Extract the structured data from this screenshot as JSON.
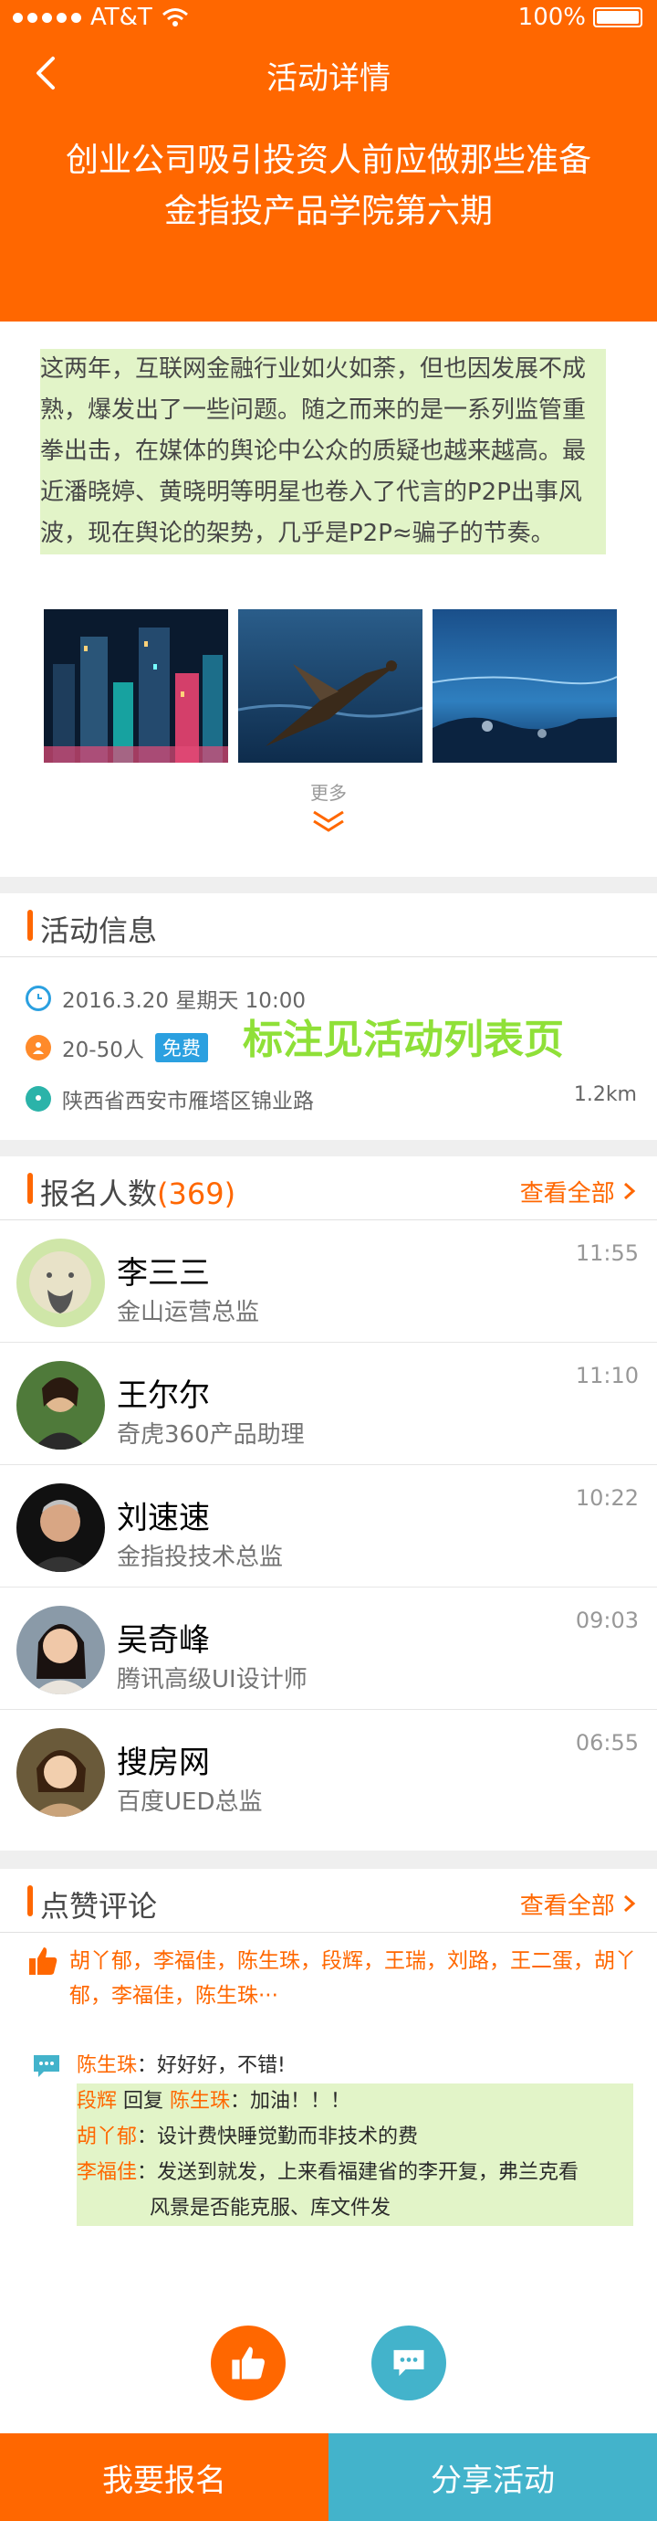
{
  "status": {
    "carrier": "AT&T",
    "battery": "100%"
  },
  "nav": {
    "title": "活动详情"
  },
  "event": {
    "title_line1": "创业公司吸引投资人前应做那些准备",
    "title_line2": "金指投产品学院第六期"
  },
  "description": {
    "text": "这两年，互联网金融行业如火如荼，但也因发展不成熟，爆发出了一些问题。随之而来的是一系列监管重拳出击，在媒体的舆论中公众的质疑也越来越高。最近潘晓婷、黄晓明等明星也卷入了代言的P2P出事风波，现在舆论的架势，几乎是P2P≈骗子的节奏。",
    "more": "更多"
  },
  "activity_info": {
    "title": "活动信息",
    "datetime": "2016.3.20  星期天 10:00",
    "people": "20-50人",
    "fee": "免费",
    "address": "陕西省西安市雁塔区锦业路",
    "distance": "1.2km",
    "annotation": "标注见活动列表页"
  },
  "signups": {
    "title": "报名人数",
    "count": "(369)",
    "view_all": "查看全部",
    "people": [
      {
        "name": "李三三",
        "title": "金山运营总监",
        "time": "11:55"
      },
      {
        "name": "王尔尔",
        "title": "奇虎360产品助理",
        "time": "11:10"
      },
      {
        "name": "刘速速",
        "title": "金指投技术总监",
        "time": "10:22"
      },
      {
        "name": "吴奇峰",
        "title": "腾讯高级UI设计师",
        "time": "09:03"
      },
      {
        "name": "搜房网",
        "title": "百度UED总监",
        "time": "06:55"
      }
    ]
  },
  "comments": {
    "title": "点赞评论",
    "view_all": "查看全部",
    "likes": "胡丫郁，李福佳，陈生珠，段辉，王瑞，刘路，王二蛋，胡丫郁，李福佳，陈生珠···",
    "c1_name": "陈生珠",
    "c1_text": "：好好好，不错!",
    "c2_name": "段辉",
    "c2_reply": " 回复 ",
    "c2_target": "陈生珠",
    "c2_text": "：加油！！！",
    "c3_name": "胡丫郁",
    "c3_text": "：设计费快睡觉勤而非技术的费",
    "c4_name": "李福佳",
    "c4_text": "：发送到就发，上来看福建省的李开复，弗兰克看",
    "c4_text2": "风景是否能克服、库文件发"
  },
  "bottom": {
    "signup": "我要报名",
    "share": "分享活动"
  },
  "colors": {
    "accent": "#ff6700",
    "share": "#43b3cb",
    "free_tag": "#2ba0e0"
  }
}
